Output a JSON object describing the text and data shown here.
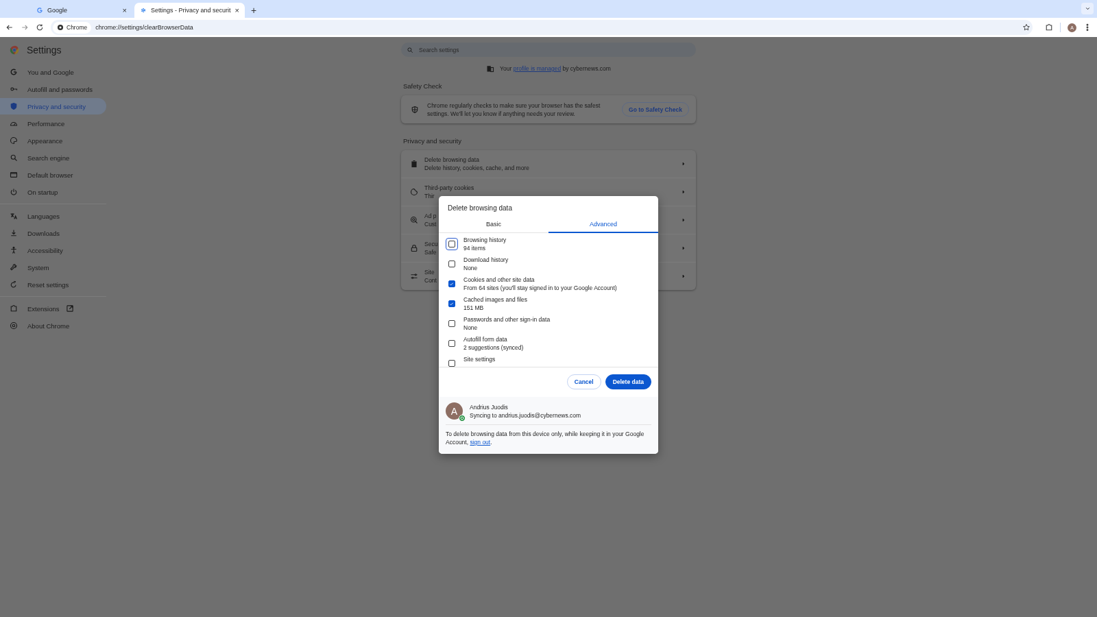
{
  "browser": {
    "tabs": [
      {
        "title": "Google",
        "close": "×",
        "selected": false
      },
      {
        "title": "Settings - Privacy and securit",
        "close": "×",
        "selected": true
      }
    ],
    "new_tab": "+",
    "address": {
      "chip": "Chrome",
      "url": "chrome://settings/clearBrowserData"
    },
    "profile_initial": "A"
  },
  "sidebar": {
    "title": "Settings",
    "groups": [
      [
        {
          "label": "You and Google",
          "selected": false
        },
        {
          "label": "Autofill and passwords",
          "selected": false
        },
        {
          "label": "Privacy and security",
          "selected": true
        },
        {
          "label": "Performance",
          "selected": false
        },
        {
          "label": "Appearance",
          "selected": false
        },
        {
          "label": "Search engine",
          "selected": false
        },
        {
          "label": "Default browser",
          "selected": false
        },
        {
          "label": "On startup",
          "selected": false
        }
      ],
      [
        {
          "label": "Languages",
          "selected": false
        },
        {
          "label": "Downloads",
          "selected": false
        },
        {
          "label": "Accessibility",
          "selected": false
        },
        {
          "label": "System",
          "selected": false
        },
        {
          "label": "Reset settings",
          "selected": false
        }
      ],
      [
        {
          "label": "Extensions",
          "selected": false,
          "kind": "external"
        },
        {
          "label": "About Chrome",
          "selected": false,
          "kind": "page"
        }
      ]
    ]
  },
  "search": {
    "placeholder": "Search settings"
  },
  "managed_notice": {
    "before": "Your",
    "link": "profile is managed",
    "after": "by cybernews.com"
  },
  "safety_check": {
    "heading": "Safety Check",
    "text": "Chrome regularly checks to make sure your browser has the safest settings. We'll let you know if anything needs your review.",
    "button": "Go to Safety Check"
  },
  "privacy": {
    "heading": "Privacy and security",
    "rows": [
      {
        "title": "Delete browsing data",
        "subtitle": "Delete history, cookies, cache, and more"
      },
      {
        "title": "Third-party cookies",
        "subtitle": "Thir"
      },
      {
        "title": "Ad p",
        "subtitle": "Cust"
      },
      {
        "title": "Secu",
        "subtitle": "Safe"
      },
      {
        "title": "Site",
        "subtitle": "Cont"
      }
    ]
  },
  "dialog": {
    "title": "Delete browsing data",
    "tabs": [
      {
        "label": "Basic",
        "selected": false
      },
      {
        "label": "Advanced",
        "selected": true
      }
    ],
    "items": [
      {
        "label": "Browsing history",
        "detail": "94 items",
        "checked": false,
        "focused": true
      },
      {
        "label": "Download history",
        "detail": "None",
        "checked": false,
        "focused": false
      },
      {
        "label": "Cookies and other site data",
        "detail": "From 64 sites (you'll stay signed in to your Google Account)",
        "checked": true,
        "focused": false
      },
      {
        "label": "Cached images and files",
        "detail": "151 MB",
        "checked": true,
        "focused": false
      },
      {
        "label": "Passwords and other sign-in data",
        "detail": "None",
        "checked": false,
        "focused": false
      },
      {
        "label": "Autofill form data",
        "detail": "2 suggestions (synced)",
        "checked": false,
        "focused": false
      },
      {
        "label": "Site settings",
        "checked": false,
        "focused": false
      }
    ],
    "cancel": "Cancel",
    "confirm": "Delete data",
    "account": {
      "initial": "A",
      "name": "Andrius Juodis",
      "status": "Syncing to andrius.juodis@cybernews.com"
    },
    "note": {
      "text": "To delete browsing data from this device only, while keeping it in your Google Account,",
      "link": "sign out",
      "end": "."
    }
  }
}
